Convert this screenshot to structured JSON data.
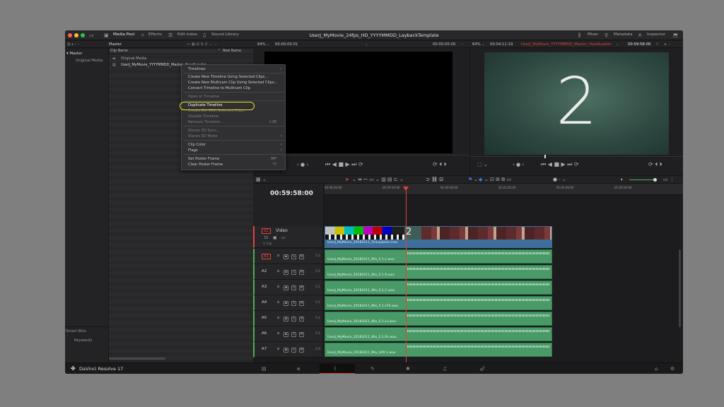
{
  "window": {
    "title": "UserJ_MyMovie_24fps_HD_YYYYMMDD_LaybackTemplate"
  },
  "toolbar": {
    "media_pool": "Media Pool",
    "effects": "Effects",
    "edit_index": "Edit Index",
    "sound_library": "Sound Library",
    "mixer": "Mixer",
    "metadata": "Metadata",
    "inspector": "Inspector"
  },
  "subbar": {
    "bin_title": "Master",
    "source_zoom": "64%",
    "source_tc": "00:00:00:01",
    "source_tc_right": "00:00:00:00",
    "program_zoom": "64%",
    "program_duration": "00:04:11:19",
    "program_timeline_name": "UserJ_MyMovie_YYYYMMDD_Master_HeadLeader",
    "program_tc": "00:59:58:00"
  },
  "bins": {
    "master": "Master",
    "original_media": "Original Media",
    "smart_bins": "Smart Bins",
    "keywords": "Keywords"
  },
  "clip_list": {
    "col_name": "Clip Name",
    "col_reel": "Reel Name",
    "items": [
      "Original Media",
      "UserJ_MyMovie_YYYYMMDD_Master_HeadLeader"
    ]
  },
  "context_menu": {
    "timelines": "Timelines",
    "new_timeline_selected": "Create New Timeline Using Selected Clips...",
    "new_multicam": "Create New Multicam Clip Using Selected Clips...",
    "convert_multicam": "Convert Timeline to Multicam Clip",
    "open_in_timeline": "Open In Timeline",
    "duplicate_timeline": "Duplicate Timeline",
    "create_bin": "Create Bin With Selected Clips",
    "disable_timeline": "Disable Timeline",
    "remove_timeline": "Remove Timeline...",
    "remove_shortcut": "⇧⌫",
    "stereo_sync": "Stereo 3D Sync...",
    "stereo_mode": "Stereo 3D Mode",
    "clip_color": "Clip Color",
    "flags": "Flags",
    "set_poster": "Set Poster Frame",
    "set_poster_shortcut": "⌘P",
    "clear_poster": "Clear Poster Frame",
    "clear_poster_shortcut": "⌃P"
  },
  "program_viewer": {
    "frame_text": "2"
  },
  "timeline": {
    "timecode": "00:59:58:00",
    "ruler": [
      "00:58:30:00",
      "00:59:34:00",
      "01:00:38:00",
      "01:01:42:00",
      "01:02:46:00",
      "01:03:50:00"
    ],
    "video_track": {
      "id": "V1",
      "name": "Video",
      "clip_count": "1 Clip",
      "clip_name": "UserJ_MyMovie_20181011_FinLayback.mov"
    },
    "audio_tracks": [
      {
        "id": "A1",
        "ch": "5.1",
        "clip": "UserJ_MyMovie_20181011_Mix_5.1.L.wav"
      },
      {
        "id": "A2",
        "ch": "5.1",
        "clip": "UserJ_MyMovie_20181011_Mix_5.1.R.wav"
      },
      {
        "id": "A3",
        "ch": "5.1",
        "clip": "UserJ_MyMovie_20181011_Mix_5.1.C.wav"
      },
      {
        "id": "A4",
        "ch": "5.1",
        "clip": "UserJ_MyMovie_20181011_Mix_5.1.LFE.wav"
      },
      {
        "id": "A5",
        "ch": "5.1",
        "clip": "UserJ_MyMovie_20181011_Mix_5.1.Ls.wav"
      },
      {
        "id": "A6",
        "ch": "5.1",
        "clip": "UserJ_MyMovie_20181011_Mix_5.1.Rs.wav"
      },
      {
        "id": "A7",
        "ch": "2.0",
        "clip": "UserJ_MyMovie_20181011_Mix_LtRt.L.wav"
      }
    ]
  },
  "app": {
    "name": "DaVinci Resolve 17"
  },
  "colors": {
    "accent_red": "#e0433f",
    "audio_clip": "#4a9a68",
    "video_clip_bar": "#3d6e9c",
    "highlight": "#e8e02a"
  }
}
